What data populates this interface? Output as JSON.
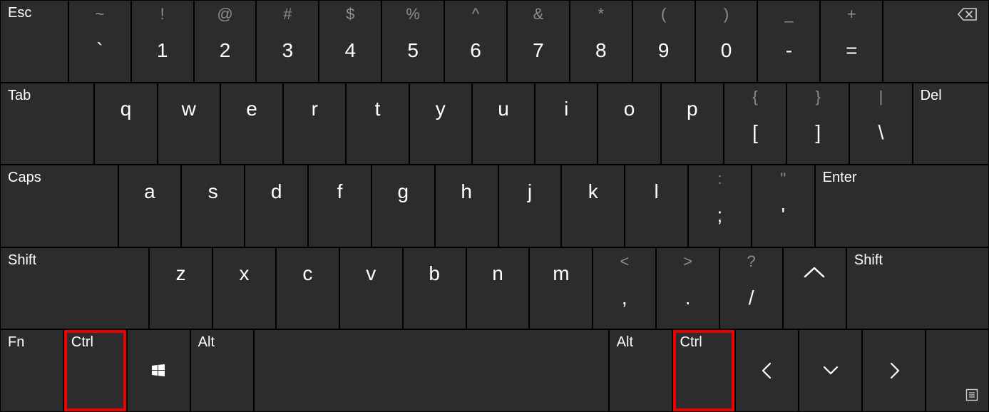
{
  "rows": [
    [
      {
        "id": "esc",
        "label": "Esc",
        "type": "corner",
        "flex": 94
      },
      {
        "id": "backtick",
        "upper": "~",
        "lower": "`",
        "type": "dual",
        "flex": 86
      },
      {
        "id": "1",
        "upper": "!",
        "lower": "1",
        "type": "dual",
        "flex": 86
      },
      {
        "id": "2",
        "upper": "@",
        "lower": "2",
        "type": "dual",
        "flex": 86
      },
      {
        "id": "3",
        "upper": "#",
        "lower": "3",
        "type": "dual",
        "flex": 86
      },
      {
        "id": "4",
        "upper": "$",
        "lower": "4",
        "type": "dual",
        "flex": 86
      },
      {
        "id": "5",
        "upper": "%",
        "lower": "5",
        "type": "dual",
        "flex": 86
      },
      {
        "id": "6",
        "upper": "^",
        "lower": "6",
        "type": "dual",
        "flex": 86
      },
      {
        "id": "7",
        "upper": "&",
        "lower": "7",
        "type": "dual",
        "flex": 86
      },
      {
        "id": "8",
        "upper": "*",
        "lower": "8",
        "type": "dual",
        "flex": 86
      },
      {
        "id": "9",
        "upper": "(",
        "lower": "9",
        "type": "dual",
        "flex": 86
      },
      {
        "id": "0",
        "upper": ")",
        "lower": "0",
        "type": "dual",
        "flex": 86
      },
      {
        "id": "minus",
        "upper": "_",
        "lower": "-",
        "type": "dual",
        "flex": 86
      },
      {
        "id": "equals",
        "upper": "+",
        "lower": "=",
        "type": "dual",
        "flex": 86
      },
      {
        "id": "backspace",
        "type": "backspace",
        "flex": 147
      }
    ],
    [
      {
        "id": "tab",
        "label": "Tab",
        "type": "corner",
        "flex": 130
      },
      {
        "id": "q",
        "lower": "q",
        "type": "letter",
        "flex": 86
      },
      {
        "id": "w",
        "lower": "w",
        "type": "letter",
        "flex": 86
      },
      {
        "id": "e",
        "lower": "e",
        "type": "letter",
        "flex": 86
      },
      {
        "id": "r",
        "lower": "r",
        "type": "letter",
        "flex": 86
      },
      {
        "id": "t",
        "lower": "t",
        "type": "letter",
        "flex": 86
      },
      {
        "id": "y",
        "lower": "y",
        "type": "letter",
        "flex": 86
      },
      {
        "id": "u",
        "lower": "u",
        "type": "letter",
        "flex": 86
      },
      {
        "id": "i",
        "lower": "i",
        "type": "letter",
        "flex": 86
      },
      {
        "id": "o",
        "lower": "o",
        "type": "letter",
        "flex": 86
      },
      {
        "id": "p",
        "lower": "p",
        "type": "letter",
        "flex": 86
      },
      {
        "id": "bracket-open",
        "upper": "{",
        "lower": "[",
        "type": "dual",
        "flex": 86
      },
      {
        "id": "bracket-close",
        "upper": "}",
        "lower": "]",
        "type": "dual",
        "flex": 86
      },
      {
        "id": "backslash",
        "upper": "|",
        "lower": "\\",
        "type": "dual",
        "flex": 86
      },
      {
        "id": "del",
        "label": "Del",
        "type": "corner",
        "flex": 105
      }
    ],
    [
      {
        "id": "caps",
        "label": "Caps",
        "type": "corner",
        "flex": 162
      },
      {
        "id": "a",
        "lower": "a",
        "type": "letter",
        "flex": 86
      },
      {
        "id": "s",
        "lower": "s",
        "type": "letter",
        "flex": 86
      },
      {
        "id": "d",
        "lower": "d",
        "type": "letter",
        "flex": 86
      },
      {
        "id": "f",
        "lower": "f",
        "type": "letter",
        "flex": 86
      },
      {
        "id": "g",
        "lower": "g",
        "type": "letter",
        "flex": 86
      },
      {
        "id": "h",
        "lower": "h",
        "type": "letter",
        "flex": 86
      },
      {
        "id": "j",
        "lower": "j",
        "type": "letter",
        "flex": 86
      },
      {
        "id": "k",
        "lower": "k",
        "type": "letter",
        "flex": 86
      },
      {
        "id": "l",
        "lower": "l",
        "type": "letter",
        "flex": 86
      },
      {
        "id": "semicolon",
        "upper": ":",
        "lower": ";",
        "type": "dual",
        "flex": 86
      },
      {
        "id": "quote",
        "upper": "\"",
        "lower": "'",
        "type": "dual",
        "flex": 86
      },
      {
        "id": "enter",
        "label": "Enter",
        "type": "corner",
        "flex": 240
      }
    ],
    [
      {
        "id": "shift-left",
        "label": "Shift",
        "type": "corner",
        "flex": 205
      },
      {
        "id": "z",
        "lower": "z",
        "type": "letter",
        "flex": 86
      },
      {
        "id": "x",
        "lower": "x",
        "type": "letter",
        "flex": 86
      },
      {
        "id": "c",
        "lower": "c",
        "type": "letter",
        "flex": 86
      },
      {
        "id": "v",
        "lower": "v",
        "type": "letter",
        "flex": 86
      },
      {
        "id": "b",
        "lower": "b",
        "type": "letter",
        "flex": 86
      },
      {
        "id": "n",
        "lower": "n",
        "type": "letter",
        "flex": 86
      },
      {
        "id": "m",
        "lower": "m",
        "type": "letter",
        "flex": 86
      },
      {
        "id": "comma",
        "upper": "<",
        "lower": ",",
        "type": "dual",
        "flex": 86
      },
      {
        "id": "period",
        "upper": ">",
        "lower": ".",
        "type": "dual",
        "flex": 86
      },
      {
        "id": "slash",
        "upper": "?",
        "lower": "/",
        "type": "dual",
        "flex": 86
      },
      {
        "id": "up",
        "type": "up-arrow",
        "flex": 86
      },
      {
        "id": "shift-right",
        "label": "Shift",
        "type": "corner",
        "flex": 196
      }
    ],
    [
      {
        "id": "fn",
        "label": "Fn",
        "type": "corner",
        "flex": 86
      },
      {
        "id": "ctrl-left",
        "label": "Ctrl",
        "type": "corner",
        "flex": 86,
        "highlighted": true
      },
      {
        "id": "win",
        "type": "win-icon",
        "flex": 86
      },
      {
        "id": "alt-left",
        "label": "Alt",
        "type": "corner",
        "flex": 86
      },
      {
        "id": "space",
        "type": "blank",
        "flex": 491
      },
      {
        "id": "alt-right",
        "label": "Alt",
        "type": "corner",
        "flex": 86
      },
      {
        "id": "ctrl-right",
        "label": "Ctrl",
        "type": "corner",
        "flex": 86,
        "highlighted": true
      },
      {
        "id": "left",
        "type": "left-arrow",
        "flex": 86
      },
      {
        "id": "down",
        "type": "down-arrow",
        "flex": 86
      },
      {
        "id": "right",
        "type": "right-arrow",
        "flex": 86
      },
      {
        "id": "menu",
        "type": "menu-icon",
        "flex": 86
      }
    ]
  ]
}
